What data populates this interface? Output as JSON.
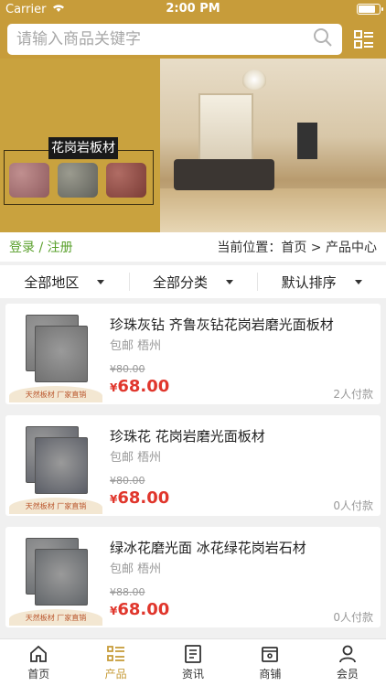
{
  "status": {
    "carrier": "Carrier",
    "time": "2:00 PM"
  },
  "search": {
    "placeholder": "请输入商品关键字"
  },
  "banner": {
    "sample_title": "花岗岩板材"
  },
  "crumbs": {
    "login": "登录",
    "separator": "/",
    "register": "注册",
    "location": "当前位置：首页 > 产品中心"
  },
  "filters": [
    {
      "label": "全部地区"
    },
    {
      "label": "全部分类"
    },
    {
      "label": "默认排序"
    }
  ],
  "products": [
    {
      "title": "珍珠灰钻 齐鲁灰钻花岗岩磨光面板材",
      "meta": "包邮 梧州",
      "original_price": "¥80.00",
      "price_symbol": "¥",
      "price": "68.00",
      "paid": "2人付款",
      "tag": "天然板材  厂家直销",
      "stone_color": "#707070"
    },
    {
      "title": "珍珠花 花岗岩磨光面板材",
      "meta": "包邮 梧州",
      "original_price": "¥80.00",
      "price_symbol": "¥",
      "price": "68.00",
      "paid": "0人付款",
      "tag": "天然板材  厂家直销",
      "stone_color": "#5a5d66"
    },
    {
      "title": "绿冰花磨光面 冰花绿花岗岩石材",
      "meta": "包邮 梧州",
      "original_price": "¥88.00",
      "price_symbol": "¥",
      "price": "68.00",
      "paid": "0人付款",
      "tag": "天然板材  厂家直销",
      "stone_color": "#62666a"
    }
  ],
  "tabs": [
    {
      "label": "首页",
      "icon": "home-icon"
    },
    {
      "label": "产品",
      "icon": "list-icon",
      "active": true
    },
    {
      "label": "资讯",
      "icon": "news-icon"
    },
    {
      "label": "商铺",
      "icon": "store-icon"
    },
    {
      "label": "会员",
      "icon": "user-icon"
    }
  ],
  "colors": {
    "accent": "#c79c3a",
    "price": "#e0362c",
    "login": "#5aa02c"
  }
}
